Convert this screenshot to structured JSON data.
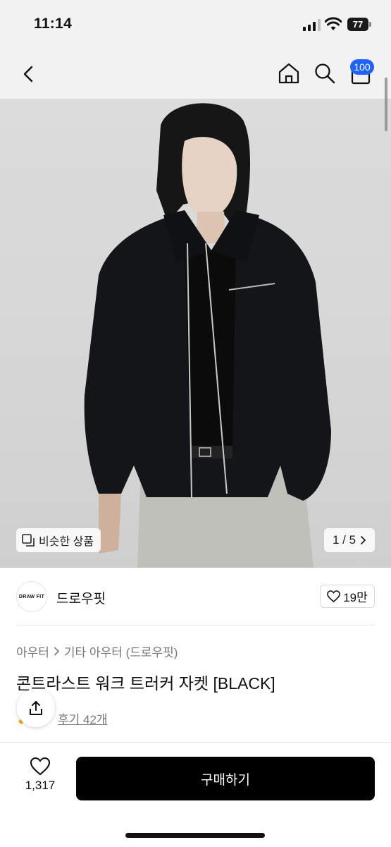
{
  "status_bar": {
    "time": "11:14",
    "battery": "77"
  },
  "nav": {
    "cart_badge": "100"
  },
  "gallery": {
    "similar_label": "비슷한 상품",
    "counter": "1 / 5"
  },
  "brand": {
    "logo_text": "DRAW FIT",
    "name": "드로우핏",
    "likes": "19만"
  },
  "product": {
    "breadcrumb": [
      "아우터",
      "기타 아우터 (드로우핏)"
    ],
    "title": "콘트라스트 워크 트러커 자켓 [BLACK]",
    "reviews": "후기 42개"
  },
  "bottom": {
    "wishlist_count": "1,317",
    "buy_label": "구매하기"
  },
  "icons": [
    "back-icon",
    "home-icon",
    "search-icon",
    "cart-icon",
    "similar-icon",
    "chevron-right-icon",
    "heart-icon",
    "share-icon"
  ],
  "colors": {
    "badge": "#1f63ff",
    "buy_button": "#000000",
    "header_bg": "#f2f2f2"
  }
}
